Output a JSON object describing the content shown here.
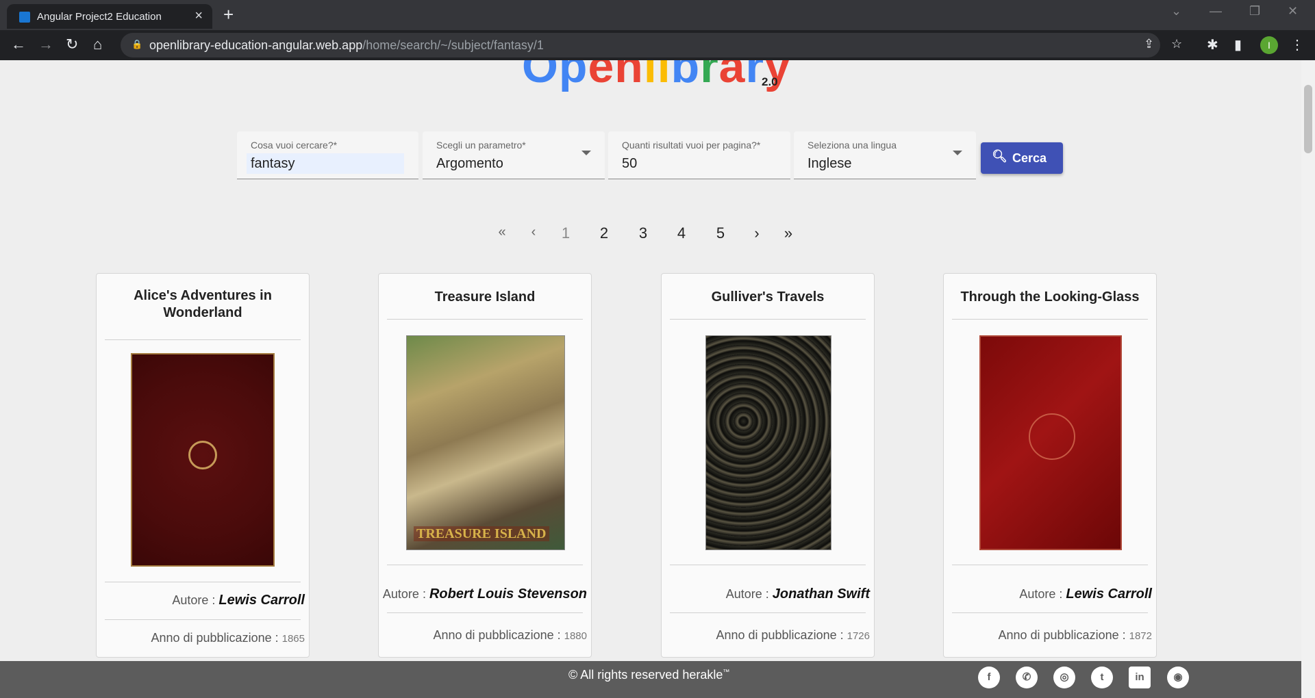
{
  "browser": {
    "tab_title": "Angular Project2 Education",
    "url_host": "openlibrary-education-angular.web.app",
    "url_path": "/home/search/~/subject/fantasy/1"
  },
  "header": {
    "logo_parts": [
      "O",
      "p",
      "e",
      "n",
      "l",
      "i",
      "b",
      "r",
      "a",
      "r",
      "y"
    ],
    "version": "2.0"
  },
  "search": {
    "query_label": "Cosa vuoi cercare?*",
    "query_value": "fantasy",
    "param_label": "Scegli un parametro*",
    "param_value": "Argomento",
    "results_label": "Quanti risultati vuoi per pagina?*",
    "results_value": "50",
    "lang_label": "Seleziona una lingua",
    "lang_value": "Inglese",
    "button_label": "Cerca"
  },
  "pagination": {
    "first": "«",
    "prev": "‹",
    "pages": [
      "1",
      "2",
      "3",
      "4",
      "5"
    ],
    "next": "›",
    "last": "»",
    "current": "1"
  },
  "books": [
    {
      "title": "Alice's Adventures in Wonderland",
      "author_label": "Autore :",
      "author": "Lewis Carroll",
      "year_label": "Anno di pubblicazione :",
      "year": "1865"
    },
    {
      "title": "Treasure Island",
      "author_label": "Autore :",
      "author": "Robert Louis Stevenson",
      "year_label": "Anno di pubblicazione :",
      "year": "1880",
      "cover_text": "TREASURE ISLAND"
    },
    {
      "title": "Gulliver's Travels",
      "author_label": "Autore :",
      "author": "Jonathan Swift",
      "year_label": "Anno di pubblicazione :",
      "year": "1726"
    },
    {
      "title": "Through the Looking-Glass",
      "author_label": "Autore :",
      "author": "Lewis Carroll",
      "year_label": "Anno di pubblicazione :",
      "year": "1872"
    }
  ],
  "footer": {
    "copyright": "© All rights reserved herakle",
    "trademark": "™",
    "social": [
      "facebook-icon",
      "whatsapp-icon",
      "instagram-icon",
      "twitter-icon",
      "linkedin-icon",
      "github-icon"
    ]
  },
  "colors": {
    "primary": "#3f51b5",
    "footer": "#5c5c5c"
  }
}
